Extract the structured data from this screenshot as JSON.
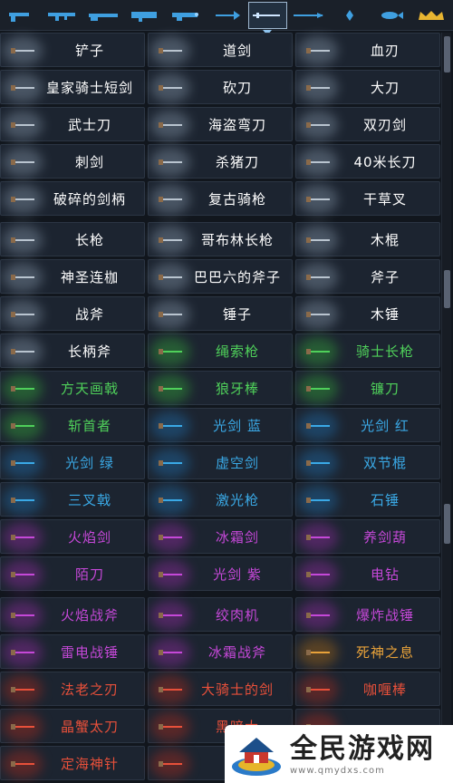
{
  "tabs": [
    {
      "icon": "pistol-icon",
      "active": false
    },
    {
      "icon": "rifle-icon",
      "active": false
    },
    {
      "icon": "shotgun-icon",
      "active": false
    },
    {
      "icon": "launcher-icon",
      "active": false
    },
    {
      "icon": "laser-gun-icon",
      "active": false
    },
    {
      "icon": "bow-icon",
      "active": false
    },
    {
      "icon": "melee-weapon-icon",
      "active": true
    },
    {
      "icon": "spear-icon",
      "active": false
    },
    {
      "icon": "staff-icon",
      "active": false
    },
    {
      "icon": "fish-icon",
      "active": false
    },
    {
      "icon": "crown-icon",
      "active": false
    }
  ],
  "weapons": [
    [
      {
        "name": "铲子",
        "color": "#ffffff"
      },
      {
        "name": "道剑",
        "color": "#ffffff"
      },
      {
        "name": "血刃",
        "color": "#ffffff"
      }
    ],
    [
      {
        "name": "皇家骑士短剑",
        "color": "#ffffff"
      },
      {
        "name": "砍刀",
        "color": "#ffffff"
      },
      {
        "name": "大刀",
        "color": "#ffffff"
      }
    ],
    [
      {
        "name": "武士刀",
        "color": "#ffffff"
      },
      {
        "name": "海盗弯刀",
        "color": "#ffffff"
      },
      {
        "name": "双刃剑",
        "color": "#ffffff"
      }
    ],
    [
      {
        "name": "刺剑",
        "color": "#ffffff"
      },
      {
        "name": "杀猪刀",
        "color": "#ffffff"
      },
      {
        "name": "40米长刀",
        "color": "#ffffff"
      }
    ],
    [
      {
        "name": "破碎的剑柄",
        "color": "#ffffff"
      },
      {
        "name": "复古骑枪",
        "color": "#ffffff"
      },
      {
        "name": "干草叉",
        "color": "#ffffff"
      }
    ],
    [
      {
        "name": "长枪",
        "color": "#ffffff"
      },
      {
        "name": "哥布林长枪",
        "color": "#ffffff"
      },
      {
        "name": "木棍",
        "color": "#ffffff"
      }
    ],
    [
      {
        "name": "神圣连枷",
        "color": "#ffffff"
      },
      {
        "name": "巴巴六的斧子",
        "color": "#ffffff"
      },
      {
        "name": "斧子",
        "color": "#ffffff"
      }
    ],
    [
      {
        "name": "战斧",
        "color": "#ffffff"
      },
      {
        "name": "锤子",
        "color": "#ffffff"
      },
      {
        "name": "木锤",
        "color": "#ffffff"
      }
    ],
    [
      {
        "name": "长柄斧",
        "color": "#ffffff"
      },
      {
        "name": "绳索枪",
        "color": "#4fd05a"
      },
      {
        "name": "骑士长枪",
        "color": "#4fd05a"
      }
    ],
    [
      {
        "name": "方天画戟",
        "color": "#4fd05a"
      },
      {
        "name": "狼牙棒",
        "color": "#4fd05a"
      },
      {
        "name": "镰刀",
        "color": "#4fd05a"
      }
    ],
    [
      {
        "name": "斩首者",
        "color": "#4fd05a"
      },
      {
        "name": "光剑 蓝",
        "color": "#3aa9e6"
      },
      {
        "name": "光剑 红",
        "color": "#3aa9e6"
      }
    ],
    [
      {
        "name": "光剑 绿",
        "color": "#3aa9e6"
      },
      {
        "name": "虚空剑",
        "color": "#3aa9e6"
      },
      {
        "name": "双节棍",
        "color": "#3aa9e6"
      }
    ],
    [
      {
        "name": "三叉戟",
        "color": "#3aa9e6"
      },
      {
        "name": "激光枪",
        "color": "#3aa9e6"
      },
      {
        "name": "石锤",
        "color": "#3aa9e6"
      }
    ],
    [
      {
        "name": "火焰剑",
        "color": "#c548d8"
      },
      {
        "name": "冰霜剑",
        "color": "#c548d8"
      },
      {
        "name": "养剑葫",
        "color": "#c548d8"
      }
    ],
    [
      {
        "name": "陌刀",
        "color": "#c548d8"
      },
      {
        "name": "光剑 紫",
        "color": "#c548d8"
      },
      {
        "name": "电钻",
        "color": "#c548d8"
      }
    ],
    [
      {
        "name": "火焰战斧",
        "color": "#c548d8"
      },
      {
        "name": "绞肉机",
        "color": "#c548d8"
      },
      {
        "name": "爆炸战锤",
        "color": "#c548d8"
      }
    ],
    [
      {
        "name": "雷电战锤",
        "color": "#c548d8"
      },
      {
        "name": "冰霜战斧",
        "color": "#c548d8"
      },
      {
        "name": "死神之息",
        "color": "#e8a23a"
      }
    ],
    [
      {
        "name": "法老之刃",
        "color": "#e8503a"
      },
      {
        "name": "大骑士的剑",
        "color": "#e8503a"
      },
      {
        "name": "咖喱棒",
        "color": "#e8503a"
      }
    ],
    [
      {
        "name": "晶蟹太刀",
        "color": "#e8503a"
      },
      {
        "name": "黑暗大",
        "color": "#e8503a"
      },
      {
        "name": "",
        "color": "#e8503a"
      }
    ],
    [
      {
        "name": "定海神针",
        "color": "#e8503a"
      },
      {
        "name": "金",
        "color": "#e8503a"
      },
      {
        "name": "",
        "color": "#e8503a"
      }
    ]
  ],
  "watermark": {
    "title": "全民游戏网",
    "url": "www.qmydxs.com"
  }
}
